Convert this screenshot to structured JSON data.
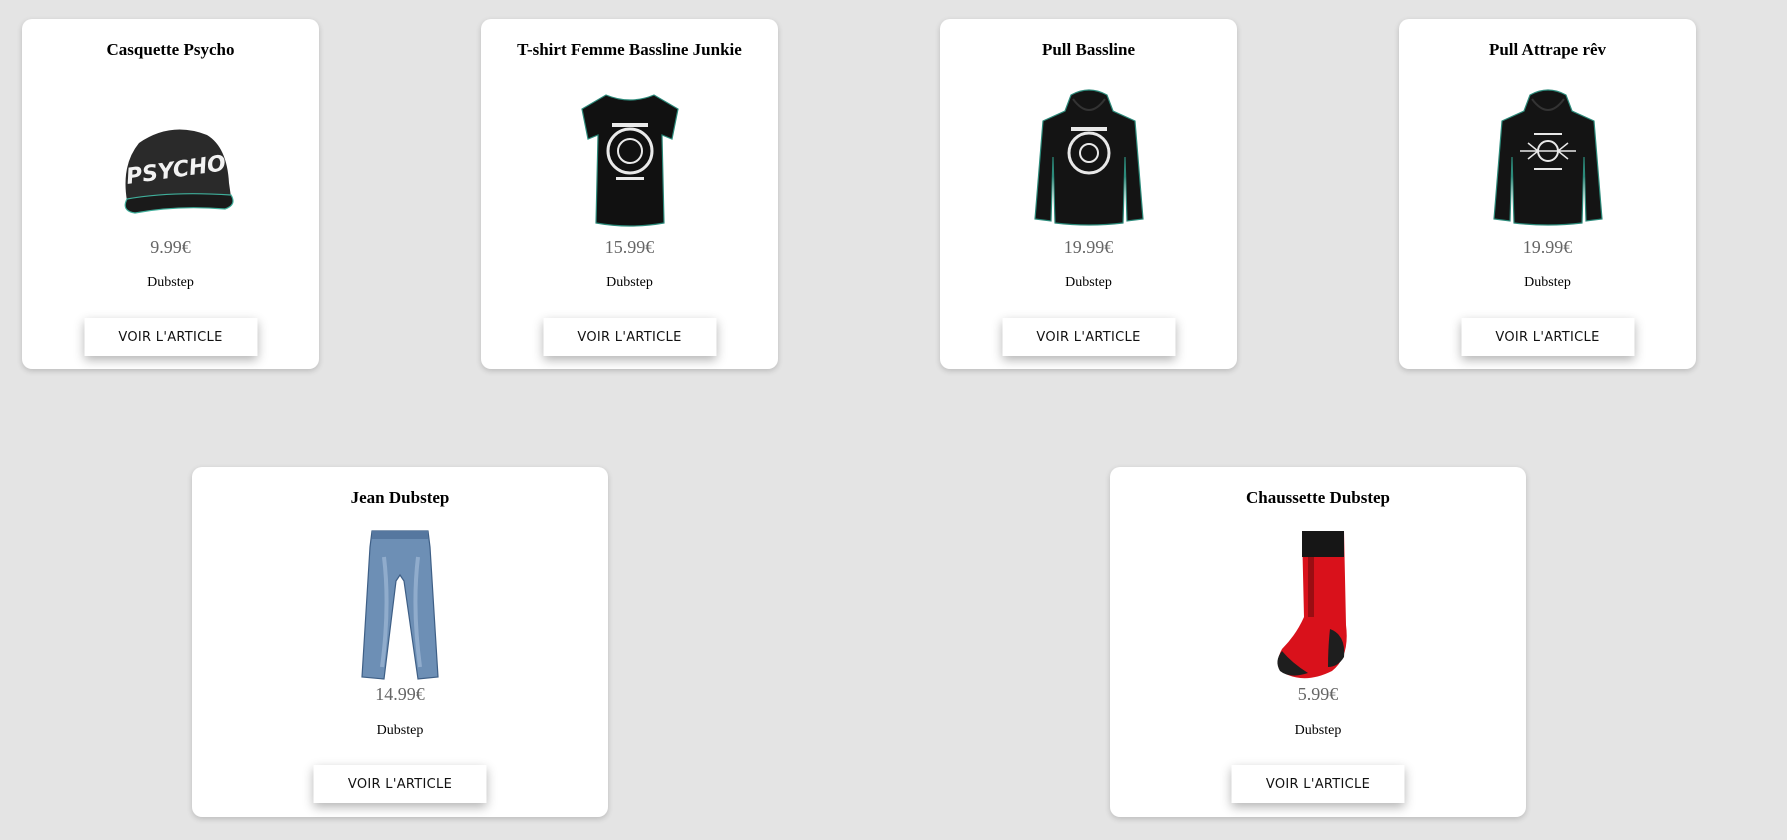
{
  "products": [
    {
      "title": "Casquette Psycho",
      "price": "9.99€",
      "category": "Dubstep",
      "button": "VOIR L'ARTICLE",
      "image": "cap-image",
      "logo_text": "PSYCHO"
    },
    {
      "title": "T-shirt Femme Bassline Junkie",
      "price": "15.99€",
      "category": "Dubstep",
      "button": "VOIR L'ARTICLE",
      "image": "tshirt-image"
    },
    {
      "title": "Pull Bassline",
      "price": "19.99€",
      "category": "Dubstep",
      "button": "VOIR L'ARTICLE",
      "image": "hoodie-image"
    },
    {
      "title": "Pull Attrape rêv",
      "price": "19.99€",
      "category": "Dubstep",
      "button": "VOIR L'ARTICLE",
      "image": "hoodie-image"
    },
    {
      "title": "Jean Dubstep",
      "price": "14.99€",
      "category": "Dubstep",
      "button": "VOIR L'ARTICLE",
      "image": "jeans-image"
    },
    {
      "title": "Chaussette Dubstep",
      "price": "5.99€",
      "category": "Dubstep",
      "button": "VOIR L'ARTICLE",
      "image": "sock-image"
    }
  ],
  "colors": {
    "background": "#e4e4e4",
    "card": "#ffffff",
    "price": "#666666",
    "sock_red": "#d9111b",
    "garment_black": "#161616",
    "denim": "#6d8fb5"
  }
}
